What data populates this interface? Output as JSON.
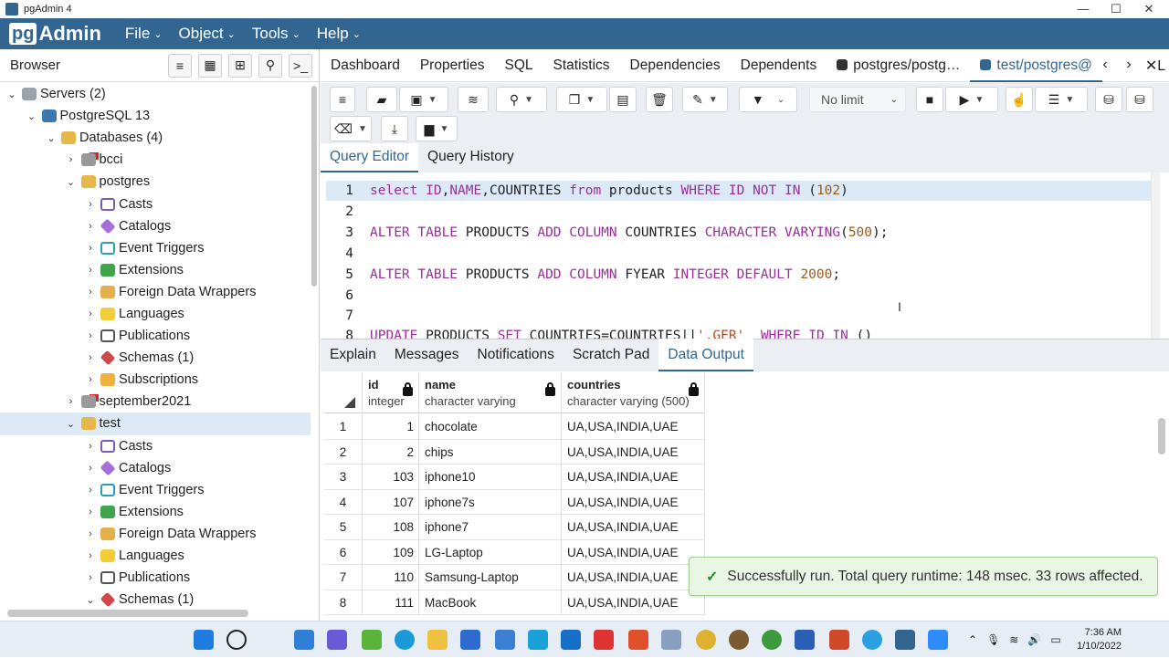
{
  "window": {
    "title": "pgAdmin 4",
    "min": "—",
    "max": "☐",
    "close": "✕"
  },
  "menu": {
    "logo_pg": "pg",
    "logo_admin": "Admin",
    "items": [
      "File",
      "Object",
      "Tools",
      "Help"
    ]
  },
  "browser": {
    "title": "Browser",
    "tree": [
      {
        "label": "Servers (2)",
        "arrow": "⌄",
        "icon": "server",
        "indent": 0
      },
      {
        "label": "PostgreSQL 13",
        "arrow": "⌄",
        "icon": "elephant",
        "indent": 1
      },
      {
        "label": "Databases (4)",
        "arrow": "⌄",
        "icon": "db",
        "indent": 2
      },
      {
        "label": "bcci",
        "arrow": "›",
        "icon": "db-red",
        "indent": 3
      },
      {
        "label": "postgres",
        "arrow": "⌄",
        "icon": "db",
        "indent": 3
      },
      {
        "label": "Casts",
        "arrow": "›",
        "icon": "cast",
        "indent": 4
      },
      {
        "label": "Catalogs",
        "arrow": "›",
        "icon": "catalog",
        "indent": 4
      },
      {
        "label": "Event Triggers",
        "arrow": "›",
        "icon": "event",
        "indent": 4
      },
      {
        "label": "Extensions",
        "arrow": "›",
        "icon": "ext",
        "indent": 4
      },
      {
        "label": "Foreign Data Wrappers",
        "arrow": "›",
        "icon": "fdw",
        "indent": 4
      },
      {
        "label": "Languages",
        "arrow": "›",
        "icon": "lang",
        "indent": 4
      },
      {
        "label": "Publications",
        "arrow": "›",
        "icon": "pub",
        "indent": 4
      },
      {
        "label": "Schemas (1)",
        "arrow": "›",
        "icon": "schema",
        "indent": 4
      },
      {
        "label": "Subscriptions",
        "arrow": "›",
        "icon": "sub",
        "indent": 4
      },
      {
        "label": "september2021",
        "arrow": "›",
        "icon": "db-red",
        "indent": 3
      },
      {
        "label": "test",
        "arrow": "⌄",
        "icon": "db",
        "indent": 3,
        "selected": true
      },
      {
        "label": "Casts",
        "arrow": "›",
        "icon": "cast",
        "indent": 4
      },
      {
        "label": "Catalogs",
        "arrow": "›",
        "icon": "catalog",
        "indent": 4
      },
      {
        "label": "Event Triggers",
        "arrow": "›",
        "icon": "event",
        "indent": 4
      },
      {
        "label": "Extensions",
        "arrow": "›",
        "icon": "ext",
        "indent": 4
      },
      {
        "label": "Foreign Data Wrappers",
        "arrow": "›",
        "icon": "fdw",
        "indent": 4
      },
      {
        "label": "Languages",
        "arrow": "›",
        "icon": "lang",
        "indent": 4
      },
      {
        "label": "Publications",
        "arrow": "›",
        "icon": "pub",
        "indent": 4
      },
      {
        "label": "Schemas (1)",
        "arrow": "⌄",
        "icon": "schema",
        "indent": 4
      }
    ]
  },
  "tabs": [
    "Dashboard",
    "Properties",
    "SQL",
    "Statistics",
    "Dependencies",
    "Dependents",
    "postgres/postg…",
    "test/postgres@"
  ],
  "tab_overflow": "✕L",
  "toolbar": {
    "limit": "No limit"
  },
  "query_tabs": [
    "Query Editor",
    "Query History"
  ],
  "editor": {
    "lines": [
      {
        "n": "1",
        "hl": true,
        "tokens": [
          [
            "kw",
            "select "
          ],
          [
            "kw",
            "ID"
          ],
          [
            "",
            ","
          ],
          [
            "kw",
            "NAME"
          ],
          [
            "",
            ",COUNTRIES "
          ],
          [
            "kw",
            "from"
          ],
          [
            "",
            " products "
          ],
          [
            "kw",
            "WHERE"
          ],
          [
            "",
            " "
          ],
          [
            "kw",
            "ID NOT IN"
          ],
          [
            "",
            " ("
          ],
          [
            "num",
            "102"
          ],
          [
            "",
            ")"
          ]
        ]
      },
      {
        "n": "2",
        "tokens": []
      },
      {
        "n": "3",
        "tokens": [
          [
            "kw",
            "ALTER TABLE"
          ],
          [
            "",
            " PRODUCTS "
          ],
          [
            "kw",
            "ADD COLUMN"
          ],
          [
            "",
            " COUNTRIES "
          ],
          [
            "kw",
            "CHARACTER VARYING"
          ],
          [
            "",
            "("
          ],
          [
            "num",
            "500"
          ],
          [
            "",
            ");"
          ]
        ]
      },
      {
        "n": "4",
        "tokens": []
      },
      {
        "n": "5",
        "tokens": [
          [
            "kw",
            "ALTER TABLE"
          ],
          [
            "",
            " PRODUCTS "
          ],
          [
            "kw",
            "ADD COLUMN"
          ],
          [
            "",
            " FYEAR "
          ],
          [
            "kw",
            "INTEGER DEFAULT"
          ],
          [
            "",
            " "
          ],
          [
            "num",
            "2000"
          ],
          [
            "",
            ";"
          ]
        ]
      },
      {
        "n": "6",
        "tokens": []
      },
      {
        "n": "7",
        "tokens": []
      },
      {
        "n": "8",
        "tokens": [
          [
            "kw",
            "UPDATE"
          ],
          [
            "",
            " PRODUCTS "
          ],
          [
            "kw",
            "SET"
          ],
          [
            "",
            " COUNTRIES=COUNTRIES||"
          ],
          [
            "str",
            "',GER'"
          ],
          [
            "",
            "  "
          ],
          [
            "kw",
            "WHERE"
          ],
          [
            "",
            " "
          ],
          [
            "kw",
            "ID IN"
          ],
          [
            "",
            " ()"
          ]
        ]
      }
    ]
  },
  "output_tabs": [
    "Explain",
    "Messages",
    "Notifications",
    "Scratch Pad",
    "Data Output"
  ],
  "grid": {
    "columns": [
      {
        "name": "id",
        "type": "integer"
      },
      {
        "name": "name",
        "type": "character varying"
      },
      {
        "name": "countries",
        "type": "character varying (500)"
      }
    ],
    "rows": [
      [
        "1",
        "1",
        "chocolate",
        "UA,USA,INDIA,UAE"
      ],
      [
        "2",
        "2",
        "chips",
        "UA,USA,INDIA,UAE"
      ],
      [
        "3",
        "103",
        "iphone10",
        "UA,USA,INDIA,UAE"
      ],
      [
        "4",
        "107",
        "iphone7s",
        "UA,USA,INDIA,UAE"
      ],
      [
        "5",
        "108",
        "iphone7",
        "UA,USA,INDIA,UAE"
      ],
      [
        "6",
        "109",
        "LG-Laptop",
        "UA,USA,INDIA,UAE"
      ],
      [
        "7",
        "110",
        "Samsung-Laptop",
        "UA,USA,INDIA,UAE"
      ],
      [
        "8",
        "111",
        "MacBook",
        "UA,USA,INDIA,UAE"
      ]
    ]
  },
  "toast": {
    "icon": "✓",
    "message": "Successfully run. Total query runtime: 148 msec. 33 rows affected."
  },
  "taskbar": {
    "time": "7:36 AM",
    "date": "1/10/2022"
  },
  "colors": {
    "brand": "#326690",
    "keyword": "#9b2d9b",
    "number": "#9a5a1a",
    "success_bg": "#e9f5e5"
  }
}
